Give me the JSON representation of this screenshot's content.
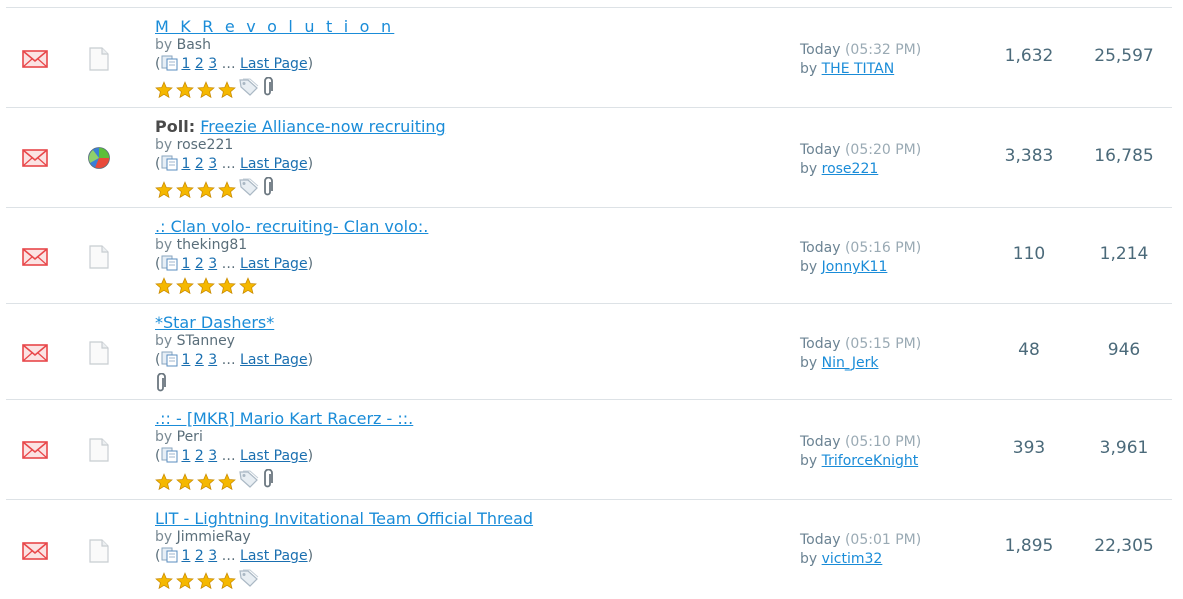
{
  "threads": [
    {
      "prefix": "",
      "title": "M K R e v o l u t i o n",
      "spaced": true,
      "by_label": "by",
      "author": "Bash",
      "pages": [
        "1",
        "2",
        "3"
      ],
      "ellipsis": "…",
      "last_page": "Last Page",
      "stars": 4,
      "has_tag": true,
      "has_clip": true,
      "status_icon": "doc-icon",
      "last_post": {
        "day": "Today",
        "time": "(05:32 PM)",
        "by_label": "by",
        "user": "THE TITAN"
      },
      "replies": "1,632",
      "views": "25,597"
    },
    {
      "prefix": "Poll:",
      "title": "Freezie Alliance-now recruiting",
      "spaced": false,
      "by_label": "by",
      "author": "rose221",
      "pages": [
        "1",
        "2",
        "3"
      ],
      "ellipsis": "…",
      "last_page": "Last Page",
      "stars": 4,
      "has_tag": true,
      "has_clip": true,
      "status_icon": "poll-icon",
      "last_post": {
        "day": "Today",
        "time": "(05:20 PM)",
        "by_label": "by",
        "user": "rose221"
      },
      "replies": "3,383",
      "views": "16,785"
    },
    {
      "prefix": "",
      "title": ".: Clan volo- recruiting- Clan volo:.",
      "spaced": false,
      "by_label": "by",
      "author": "theking81",
      "pages": [
        "1",
        "2",
        "3"
      ],
      "ellipsis": "…",
      "last_page": "Last Page",
      "stars": 5,
      "has_tag": false,
      "has_clip": false,
      "status_icon": "doc-icon",
      "last_post": {
        "day": "Today",
        "time": "(05:16 PM)",
        "by_label": "by",
        "user": "JonnyK11"
      },
      "replies": "110",
      "views": "1,214"
    },
    {
      "prefix": "",
      "title": "*Star Dashers*",
      "spaced": false,
      "by_label": "by",
      "author": "STanney",
      "pages": [
        "1",
        "2",
        "3"
      ],
      "ellipsis": "…",
      "last_page": "Last Page",
      "stars": 0,
      "has_tag": false,
      "has_clip": true,
      "status_icon": "doc-icon",
      "last_post": {
        "day": "Today",
        "time": "(05:15 PM)",
        "by_label": "by",
        "user": "Nin_Jerk"
      },
      "replies": "48",
      "views": "946"
    },
    {
      "prefix": "",
      "title": ".:: - [MKR] Mario Kart Racerz - ::.",
      "spaced": false,
      "by_label": "by",
      "author": "Peri",
      "pages": [
        "1",
        "2",
        "3"
      ],
      "ellipsis": "…",
      "last_page": "Last Page",
      "stars": 4,
      "has_tag": true,
      "has_clip": true,
      "status_icon": "doc-icon",
      "last_post": {
        "day": "Today",
        "time": "(05:10 PM)",
        "by_label": "by",
        "user": "TriforceKnight"
      },
      "replies": "393",
      "views": "3,961"
    },
    {
      "prefix": "",
      "title": "LIT - Lightning Invitational Team Official Thread",
      "spaced": false,
      "by_label": "by",
      "author": "JimmieRay",
      "pages": [
        "1",
        "2",
        "3"
      ],
      "ellipsis": "…",
      "last_page": "Last Page",
      "stars": 4,
      "has_tag": true,
      "has_clip": false,
      "status_icon": "doc-icon",
      "last_post": {
        "day": "Today",
        "time": "(05:01 PM)",
        "by_label": "by",
        "user": "victim32"
      },
      "replies": "1,895",
      "views": "22,305"
    }
  ],
  "colors": {
    "link": "#1a8cd8",
    "envelope": "#e8474a",
    "star": "#f5b800",
    "divider": "#dde2e6"
  }
}
